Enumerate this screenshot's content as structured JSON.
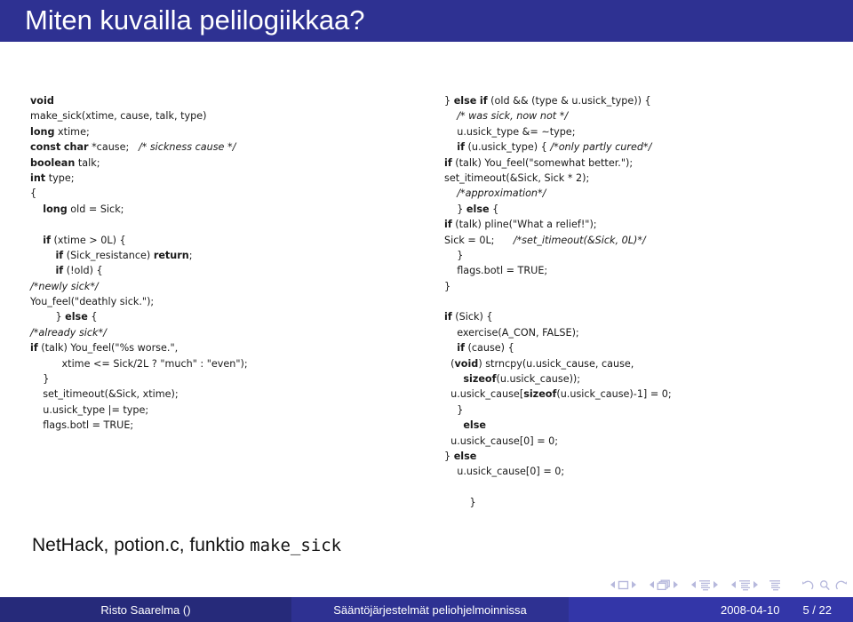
{
  "slide": {
    "title": "Miten kuvailla pelilogiikkaa?",
    "caption_text": "NetHack, potion.c, funktio ",
    "caption_mono": "make_sick"
  },
  "colors": {
    "banner": "#2e3192",
    "footer_author": "#262a7a",
    "footer_course": "#2e3192",
    "footer_meta": "#3336a8",
    "nav_icon": "#b6b8dc",
    "code_text": "#1a1a1a"
  },
  "code": {
    "left_column": [
      "void",
      "make_sick(xtime, cause, talk, type)",
      "long xtime;",
      "const char *cause;   /* sickness cause */",
      "boolean talk;",
      "int type;",
      "{",
      "    long old = Sick;",
      "",
      "    if (xtime > 0L) {",
      "        if (Sick_resistance) return;",
      "        if (!old) {",
      "/*newly sick*/",
      "You_feel(\"deathly sick.\");",
      "        } else {",
      "/*already sick*/",
      "if (talk) You_feel(\"%s worse.\",",
      "          xtime <= Sick/2L ? \"much\" : \"even\");",
      "    }",
      "    set_itimeout(&Sick, xtime);",
      "    u.usick_type |= type;",
      "    flags.botl = TRUE;"
    ],
    "right_column": [
      "} else if (old && (type & u.usick_type)) {",
      "    /* was sick, now not */",
      "    u.usick_type &= ~type;",
      "    if (u.usick_type) { /*only partly cured*/",
      "if (talk) You_feel(\"somewhat better.\");",
      "set_itimeout(&Sick, Sick * 2);",
      "    /*approximation*/",
      "    } else {",
      "if (talk) pline(\"What a relief!\");",
      "Sick = 0L;      /*set_itimeout(&Sick, 0L)*/",
      "    }",
      "    flags.botl = TRUE;",
      "}",
      "",
      "if (Sick) {",
      "    exercise(A_CON, FALSE);",
      "    if (cause) {",
      "  (void) strncpy(u.usick_cause, cause,",
      "      sizeof(u.usick_cause));",
      "  u.usick_cause[sizeof(u.usick_cause)-1] = 0;",
      "    }",
      "      else",
      "  u.usick_cause[0] = 0;",
      "} else",
      "    u.usick_cause[0] = 0;",
      "",
      "        }"
    ]
  },
  "navigation": {
    "groups": [
      {
        "icon": "single-frame-icon",
        "label": "frame"
      },
      {
        "icon": "stacked-frames-icon",
        "label": "subsection"
      },
      {
        "icon": "section-lines-icon",
        "label": "section"
      },
      {
        "icon": "section-lines-icon-2",
        "label": "presentation"
      }
    ],
    "solo": {
      "icon": "document-lines-icon",
      "label": "full-document"
    },
    "tools": [
      {
        "icon": "back-arrow-icon",
        "label": "back"
      },
      {
        "icon": "search-icon",
        "label": "search"
      },
      {
        "icon": "forward-arrow-icon",
        "label": "forward"
      }
    ]
  },
  "footer": {
    "author": "Risto Saarelma ()",
    "course": "Sääntöjärjestelmät peliohjelmoinnissa",
    "date": "2008-04-10",
    "page": "5 / 22"
  }
}
